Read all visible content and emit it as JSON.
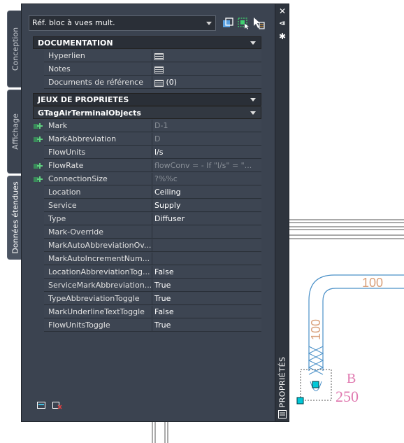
{
  "selector": {
    "value": "Réf. bloc à vues mult."
  },
  "tabs": [
    {
      "label": "Conception"
    },
    {
      "label": "Affichage"
    },
    {
      "label": "Données étendues"
    }
  ],
  "palette_title": "PROPRIÉTÉS",
  "sections": {
    "documentation": "DOCUMENTATION",
    "jeux": "JEUX DE PROPRIETES",
    "gtag": "GTagAirTerminalObjects"
  },
  "documentation_rows": [
    {
      "name": "Hyperlien",
      "icon": "document-icon",
      "value": ""
    },
    {
      "name": "Notes",
      "icon": "document-icon",
      "value": ""
    },
    {
      "name": "Documents de référence",
      "icon": "document-icon",
      "value": "(0)"
    }
  ],
  "property_rows": [
    {
      "name": "Mark",
      "value": "D-1",
      "dim": true,
      "plus": true
    },
    {
      "name": "MarkAbbreviation",
      "value": "D",
      "dim": true,
      "plus": true
    },
    {
      "name": "FlowUnits",
      "value": "l/s",
      "dim": false,
      "plus": false
    },
    {
      "name": "FlowRate",
      "value": "flowConv = - If \"l/s\" = \"...",
      "dim": true,
      "plus": true
    },
    {
      "name": "ConnectionSize",
      "value": "?%%c",
      "dim": true,
      "plus": true
    },
    {
      "name": "Location",
      "value": "Ceiling",
      "dim": false,
      "plus": false
    },
    {
      "name": "Service",
      "value": "Supply",
      "dim": false,
      "plus": false
    },
    {
      "name": "Type",
      "value": "Diffuser",
      "dim": false,
      "plus": false
    },
    {
      "name": "Mark-Override",
      "value": "",
      "dim": false,
      "plus": false
    },
    {
      "name": "MarkAutoAbbreviationOv...",
      "value": "",
      "dim": false,
      "plus": false
    },
    {
      "name": "MarkAutoIncrementNum...",
      "value": "",
      "dim": false,
      "plus": false
    },
    {
      "name": "LocationAbbreviationTog...",
      "value": "False",
      "dim": false,
      "plus": false
    },
    {
      "name": "ServiceMarkAbbreviation...",
      "value": "True",
      "dim": false,
      "plus": false
    },
    {
      "name": "TypeAbbreviationToggle",
      "value": "True",
      "dim": false,
      "plus": false
    },
    {
      "name": "MarkUnderlineTextToggle",
      "value": "False",
      "dim": false,
      "plus": false
    },
    {
      "name": "FlowUnitsToggle",
      "value": "True",
      "dim": false,
      "plus": false
    }
  ],
  "drawing": {
    "duct_label_horizontal": "100",
    "duct_label_vertical": "100",
    "tag_letter": "B",
    "tag_number": "250"
  },
  "colors": {
    "panel": "#3b4350",
    "duct": "#4a90c8",
    "label": "#d9a07a",
    "tag": "#e07ab0",
    "grip": "#00c8d8"
  }
}
